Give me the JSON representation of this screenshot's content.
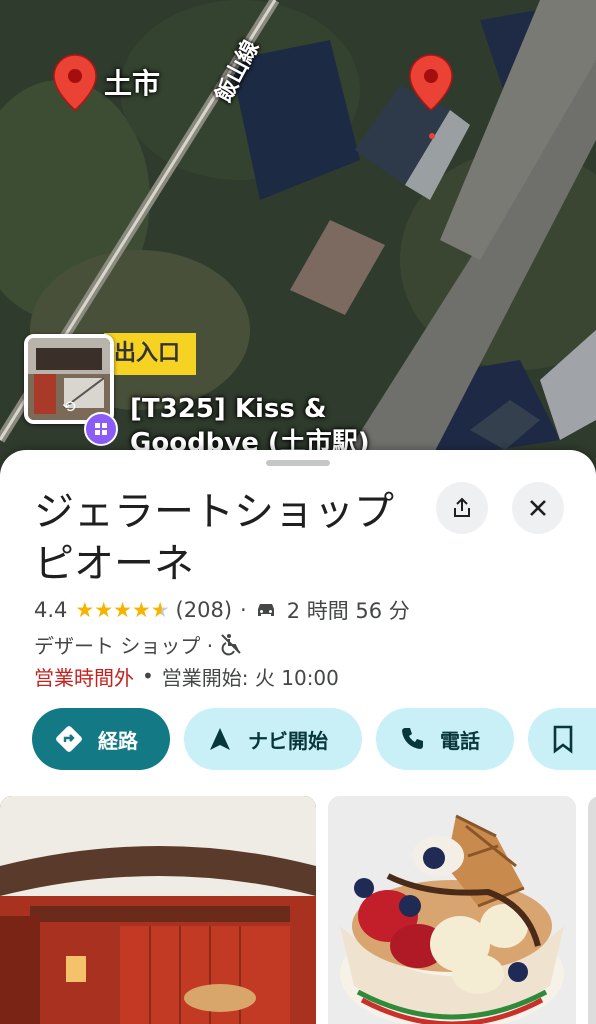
{
  "map": {
    "station_label": "土市",
    "rail_line_label": "飯山線",
    "entrance_badge": "出入口",
    "poi_label_line1": "[T325] Kiss &",
    "poi_label_line2": "Goodbye (土市駅)"
  },
  "place": {
    "name": "ジェラートショップ ピオーネ",
    "rating": "4.4",
    "stars": 4.4,
    "review_count": "(208)",
    "separator": "·",
    "drive_time": "2 時間 56 分",
    "category": "デザート ショップ ·",
    "status": "営業時間外",
    "bullet": "•",
    "opens": "営業開始: 火 10:00"
  },
  "actions": {
    "directions": "経路",
    "start": "ナビ開始",
    "call": "電話"
  },
  "icons": {
    "pin_color": "#ea4335",
    "accent": "#137a85",
    "chip_bg": "#c8f0f6"
  }
}
